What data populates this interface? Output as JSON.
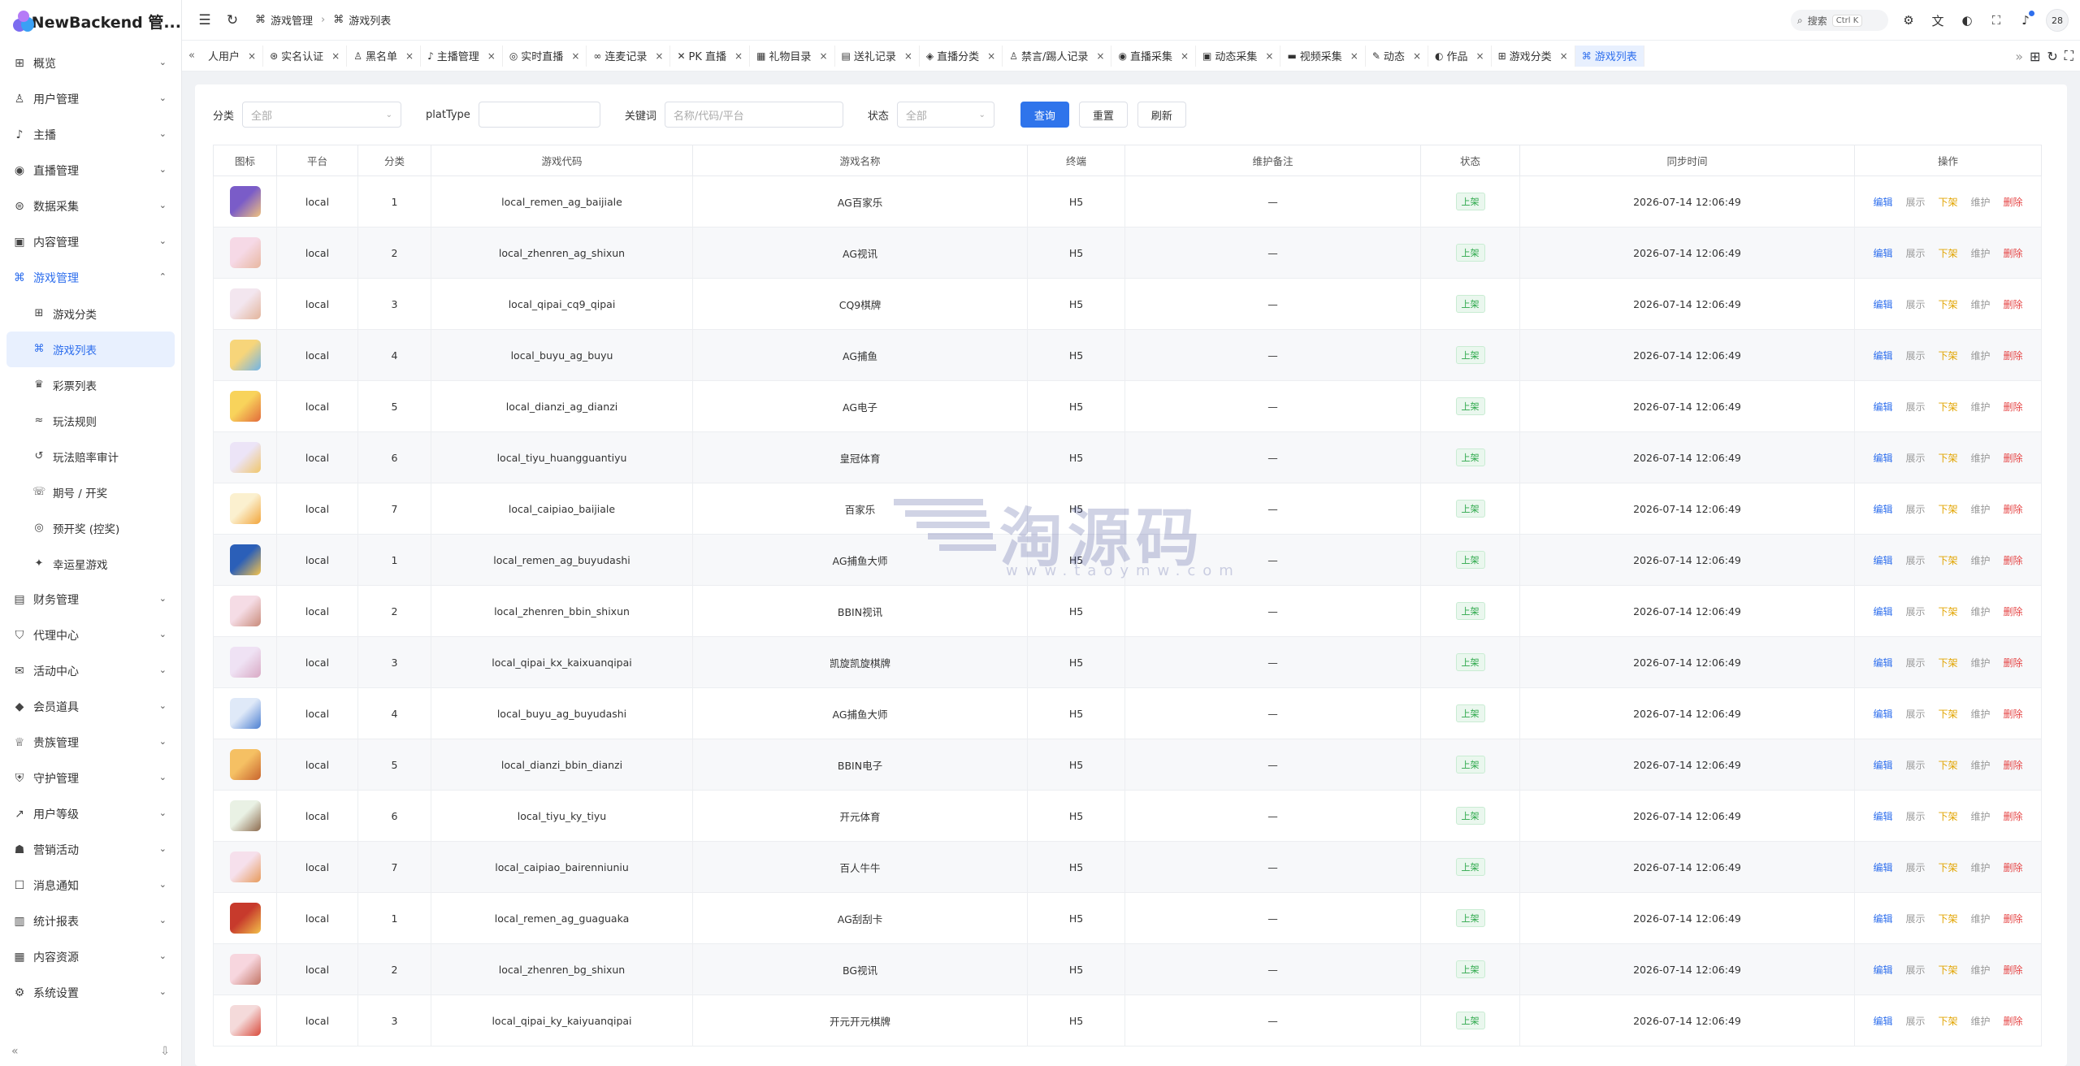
{
  "app": {
    "title": "NewBackend 管...",
    "collapse_icon": "«",
    "pin_icon": "⇩"
  },
  "sidebar": {
    "items": [
      {
        "label": "概览",
        "icon": "grid-icon",
        "glyph": "⊞"
      },
      {
        "label": "用户管理",
        "icon": "user-icon",
        "glyph": "♙"
      },
      {
        "label": "主播",
        "icon": "mic-icon",
        "glyph": "♪"
      },
      {
        "label": "直播管理",
        "icon": "broadcast-icon",
        "glyph": "◉"
      },
      {
        "label": "数据采集",
        "icon": "database-icon",
        "glyph": "⊜"
      },
      {
        "label": "内容管理",
        "icon": "content-icon",
        "glyph": "▣"
      },
      {
        "label": "游戏管理",
        "icon": "gamepad-icon",
        "glyph": "⌘"
      }
    ],
    "sub_items": [
      {
        "label": "游戏分类",
        "icon": "grid-icon",
        "glyph": "⊞"
      },
      {
        "label": "游戏列表",
        "icon": "gamepad-icon",
        "glyph": "⌘"
      },
      {
        "label": "彩票列表",
        "icon": "trophy-icon",
        "glyph": "♛"
      },
      {
        "label": "玩法规则",
        "icon": "rules-icon",
        "glyph": "≈"
      },
      {
        "label": "玩法赔率审计",
        "icon": "history-icon",
        "glyph": "↺"
      },
      {
        "label": "期号 / 开奖",
        "icon": "call-icon",
        "glyph": "☏"
      },
      {
        "label": "预开奖 (控奖)",
        "icon": "target-icon",
        "glyph": "◎"
      },
      {
        "label": "幸运星游戏",
        "icon": "star-icon",
        "glyph": "✦"
      }
    ],
    "items_after": [
      {
        "label": "财务管理",
        "icon": "finance-icon",
        "glyph": "▤"
      },
      {
        "label": "代理中心",
        "icon": "agent-icon",
        "glyph": "⛉"
      },
      {
        "label": "活动中心",
        "icon": "activity-icon",
        "glyph": "✉"
      },
      {
        "label": "会员道具",
        "icon": "diamond-icon",
        "glyph": "◆"
      },
      {
        "label": "贵族管理",
        "icon": "crown-icon",
        "glyph": "♕"
      },
      {
        "label": "守护管理",
        "icon": "shield-icon",
        "glyph": "⛨"
      },
      {
        "label": "用户等级",
        "icon": "trend-icon",
        "glyph": "↗"
      },
      {
        "label": "营销活动",
        "icon": "megaphone-icon",
        "glyph": "☗"
      },
      {
        "label": "消息通知",
        "icon": "message-icon",
        "glyph": "☐"
      },
      {
        "label": "统计报表",
        "icon": "chart-icon",
        "glyph": "▥"
      },
      {
        "label": "内容资源",
        "icon": "file-icon",
        "glyph": "▦"
      },
      {
        "label": "系统设置",
        "icon": "settings-icon",
        "glyph": "⚙"
      }
    ]
  },
  "header": {
    "breadcrumb": [
      "游戏管理",
      "游戏列表"
    ],
    "search_label": "搜索",
    "search_kbd": "Ctrl K",
    "avatar": "28"
  },
  "tabs": [
    {
      "label": "人用户",
      "glyph": ""
    },
    {
      "label": "实名认证",
      "glyph": "⊛"
    },
    {
      "label": "黑名单",
      "glyph": "♙"
    },
    {
      "label": "主播管理",
      "glyph": "♪"
    },
    {
      "label": "实时直播",
      "glyph": "◎"
    },
    {
      "label": "连麦记录",
      "glyph": "∞"
    },
    {
      "label": "PK 直播",
      "glyph": "✕"
    },
    {
      "label": "礼物目录",
      "glyph": "▦"
    },
    {
      "label": "送礼记录",
      "glyph": "▤"
    },
    {
      "label": "直播分类",
      "glyph": "◈"
    },
    {
      "label": "禁言/踢人记录",
      "glyph": "♙"
    },
    {
      "label": "直播采集",
      "glyph": "◉"
    },
    {
      "label": "动态采集",
      "glyph": "▣"
    },
    {
      "label": "视频采集",
      "glyph": "▬"
    },
    {
      "label": "动态",
      "glyph": "✎"
    },
    {
      "label": "作品",
      "glyph": "◐"
    },
    {
      "label": "游戏分类",
      "glyph": "⊞"
    },
    {
      "label": "游戏列表",
      "glyph": "⌘"
    }
  ],
  "filters": {
    "category_label": "分类",
    "category_placeholder": "全部",
    "plat_label": "platType",
    "plat_value": "",
    "keyword_label": "关键词",
    "keyword_placeholder": "名称/代码/平台",
    "status_label": "状态",
    "status_placeholder": "全部",
    "query_btn": "查询",
    "reset_btn": "重置",
    "refresh_btn": "刷新"
  },
  "table": {
    "columns": [
      "图标",
      "平台",
      "分类",
      "游戏代码",
      "游戏名称",
      "终端",
      "维护备注",
      "状态",
      "同步时间",
      "操作"
    ],
    "ops": [
      "编辑",
      "展示",
      "下架",
      "维护",
      "删除"
    ],
    "rows": [
      {
        "platform": "local",
        "category": "1",
        "code": "local_remen_ag_baijiale",
        "name": "AG百家乐",
        "terminal": "H5",
        "note": "—",
        "status": "上架",
        "time": "2026-07-14 12:06:49",
        "c1": "#7a5cc8",
        "c2": "#f1c27d"
      },
      {
        "platform": "local",
        "category": "2",
        "code": "local_zhenren_ag_shixun",
        "name": "AG视讯",
        "terminal": "H5",
        "note": "—",
        "status": "上架",
        "time": "2026-07-14 12:06:49",
        "c1": "#f6d9e6",
        "c2": "#e8b7a0"
      },
      {
        "platform": "local",
        "category": "3",
        "code": "local_qipai_cq9_qipai",
        "name": "CQ9棋牌",
        "terminal": "H5",
        "note": "—",
        "status": "上架",
        "time": "2026-07-14 12:06:49",
        "c1": "#f3e6ef",
        "c2": "#e3b49b"
      },
      {
        "platform": "local",
        "category": "4",
        "code": "local_buyu_ag_buyu",
        "name": "AG捕鱼",
        "terminal": "H5",
        "note": "—",
        "status": "上架",
        "time": "2026-07-14 12:06:49",
        "c1": "#f7d57a",
        "c2": "#6fb4e9"
      },
      {
        "platform": "local",
        "category": "5",
        "code": "local_dianzi_ag_dianzi",
        "name": "AG电子",
        "terminal": "H5",
        "note": "—",
        "status": "上架",
        "time": "2026-07-14 12:06:49",
        "c1": "#f8d35b",
        "c2": "#e26b3b"
      },
      {
        "platform": "local",
        "category": "6",
        "code": "local_tiyu_huangguantiyu",
        "name": "皇冠体育",
        "terminal": "H5",
        "note": "—",
        "status": "上架",
        "time": "2026-07-14 12:06:49",
        "c1": "#ece4f7",
        "c2": "#f0c66a"
      },
      {
        "platform": "local",
        "category": "7",
        "code": "local_caipiao_baijiale",
        "name": "百家乐",
        "terminal": "H5",
        "note": "—",
        "status": "上架",
        "time": "2026-07-14 12:06:49",
        "c1": "#fbf0cf",
        "c2": "#f2a53b"
      },
      {
        "platform": "local",
        "category": "1",
        "code": "local_remen_ag_buyudashi",
        "name": "AG捕鱼大师",
        "terminal": "H5",
        "note": "—",
        "status": "上架",
        "time": "2026-07-14 12:06:49",
        "c1": "#2b5fb8",
        "c2": "#f6c44b"
      },
      {
        "platform": "local",
        "category": "2",
        "code": "local_zhenren_bbin_shixun",
        "name": "BBIN视讯",
        "terminal": "H5",
        "note": "—",
        "status": "上架",
        "time": "2026-07-14 12:06:49",
        "c1": "#f5dce5",
        "c2": "#c98b7a"
      },
      {
        "platform": "local",
        "category": "3",
        "code": "local_qipai_kx_kaixuanqipai",
        "name": "凯旋凯旋棋牌",
        "terminal": "H5",
        "note": "—",
        "status": "上架",
        "time": "2026-07-14 12:06:49",
        "c1": "#efe2f4",
        "c2": "#d9a9c4"
      },
      {
        "platform": "local",
        "category": "4",
        "code": "local_buyu_ag_buyudashi",
        "name": "AG捕鱼大师",
        "terminal": "H5",
        "note": "—",
        "status": "上架",
        "time": "2026-07-14 12:06:49",
        "c1": "#dfe9f8",
        "c2": "#4c7fd1"
      },
      {
        "platform": "local",
        "category": "5",
        "code": "local_dianzi_bbin_dianzi",
        "name": "BBIN电子",
        "terminal": "H5",
        "note": "—",
        "status": "上架",
        "time": "2026-07-14 12:06:49",
        "c1": "#f5c063",
        "c2": "#c8642d"
      },
      {
        "platform": "local",
        "category": "6",
        "code": "local_tiyu_ky_tiyu",
        "name": "开元体育",
        "terminal": "H5",
        "note": "—",
        "status": "上架",
        "time": "2026-07-14 12:06:49",
        "c1": "#e9f1e4",
        "c2": "#8c6a4d"
      },
      {
        "platform": "local",
        "category": "7",
        "code": "local_caipiao_bairenniuniu",
        "name": "百人牛牛",
        "terminal": "H5",
        "note": "—",
        "status": "上架",
        "time": "2026-07-14 12:06:49",
        "c1": "#f6e0ec",
        "c2": "#e79a5a"
      },
      {
        "platform": "local",
        "category": "1",
        "code": "local_remen_ag_guaguaka",
        "name": "AG刮刮卡",
        "terminal": "H5",
        "note": "—",
        "status": "上架",
        "time": "2026-07-14 12:06:49",
        "c1": "#c73a2c",
        "c2": "#f2c14a"
      },
      {
        "platform": "local",
        "category": "2",
        "code": "local_zhenren_bg_shixun",
        "name": "BG视讯",
        "terminal": "H5",
        "note": "—",
        "status": "上架",
        "time": "2026-07-14 12:06:49",
        "c1": "#f7d6de",
        "c2": "#c27464"
      },
      {
        "platform": "local",
        "category": "3",
        "code": "local_qipai_ky_kaiyuanqipai",
        "name": "开元开元棋牌",
        "terminal": "H5",
        "note": "—",
        "status": "上架",
        "time": "2026-07-14 12:06:49",
        "c1": "#f4dada",
        "c2": "#d94a3b"
      }
    ]
  },
  "watermark": {
    "big": "淘源码",
    "small": "www.taoymw.com"
  },
  "colors": {
    "accent": "#2f6fed",
    "primary_btn": "#2f74eb",
    "status_green": "#2ca84a",
    "down_op": "#e2a400",
    "delete_op": "#e54545"
  }
}
